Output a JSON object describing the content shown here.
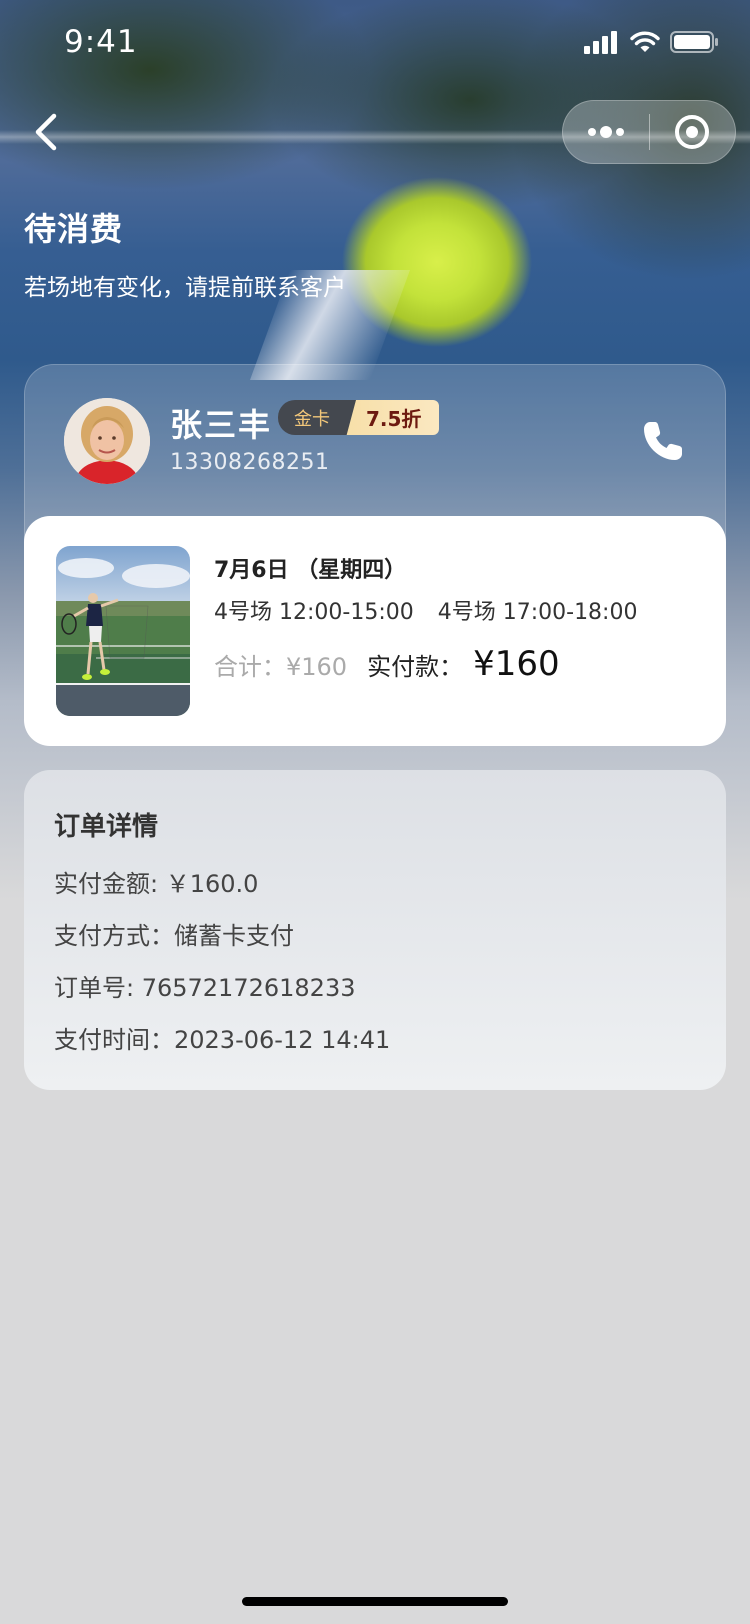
{
  "status_bar": {
    "time": "9:41"
  },
  "header": {
    "title": "待消费",
    "subtitle": "若场地有变化，请提前联系客户"
  },
  "user": {
    "name": "张三丰",
    "level": "金卡",
    "discount": "7.5折",
    "phone": "13308268251"
  },
  "booking": {
    "date": "7月6日 （星期四）",
    "slots": [
      "4号场 12:00-15:00",
      "4号场 17:00-18:00"
    ],
    "total": "合计：¥160",
    "paid_label": "实付款：",
    "paid_value": "¥160"
  },
  "order_details": {
    "title": "订单详情",
    "lines": [
      "实付金额: ￥160.0",
      "支付方式：储蓄卡支付",
      "订单号: 76572172618233",
      "支付时间：2023-06-12 14:41"
    ]
  },
  "icons": {
    "back": "chevron-left-icon",
    "more": "more-dots-icon",
    "close": "target-circle-icon",
    "call": "phone-icon"
  },
  "colors": {
    "tag_gold_text": "#f2c77a",
    "discount_text": "#6d1a10",
    "muted_total": "#aaaaaa"
  }
}
